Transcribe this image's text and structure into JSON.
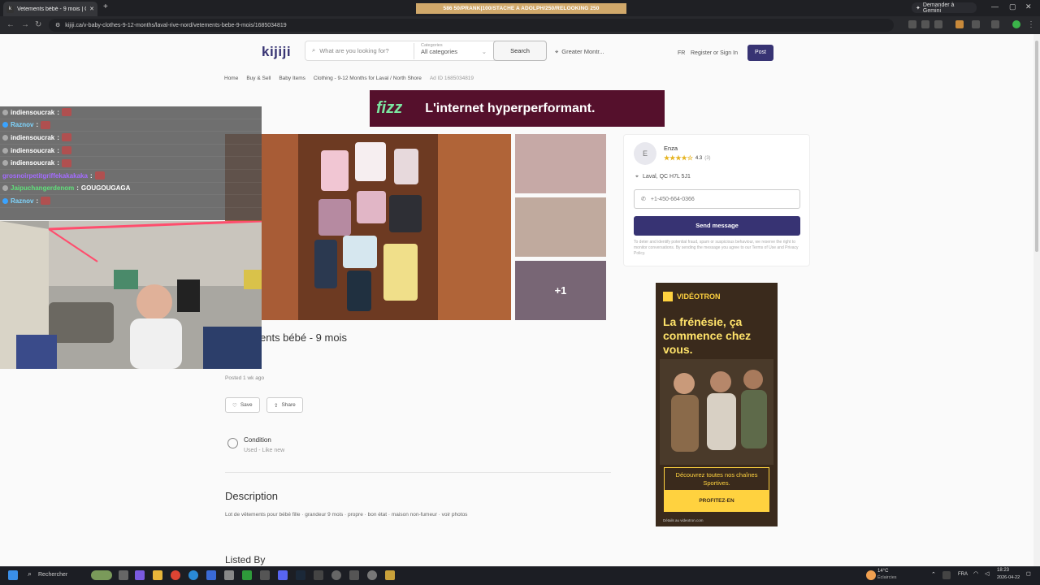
{
  "browser": {
    "tab_title": "Vetements bébé - 9 mois | Clo",
    "tab_favicon": "k",
    "new_tab": "+",
    "stream_banner": "586        50/PRANK|100/STACHE A ADOLPH/250/RELOOKING 250",
    "gemini_label": "Demander à Gemini",
    "url": "kijiji.ca/v-baby-clothes-9-12-months/laval-rive-nord/vetements-bebe-9-mois/1685034819",
    "controls": [
      "—",
      "▢",
      "✕"
    ]
  },
  "header": {
    "logo": "kijiji",
    "search_placeholder": "What are you looking for?",
    "categories_label": "Categories",
    "categories_value": "All categories",
    "search_button": "Search",
    "location": "Greater Montr...",
    "lang": "FR",
    "register": "Register or Sign In",
    "post_button": "Post"
  },
  "breadcrumb": [
    "Home",
    "Buy & Sell",
    "Baby Items",
    "Clothing - 9-12 Months for Laval / North Shore",
    "Ad ID 1685034819"
  ],
  "top_ad": {
    "brand": "fizz",
    "slogan": "L'internet hyperperformant."
  },
  "listing": {
    "title": "ents bébé - 9 mois",
    "more_photos": "+1",
    "posted": "Posted 1 wk ago",
    "save": "Save",
    "share": "Share",
    "condition_label": "Condition",
    "condition_value": "Used - Like new",
    "description_heading": "Description",
    "description": "Lot de vêtements pour bébé fille · grandeur 9 mois · propre · bon état · maison non-fumeur · voir photos",
    "listed_by": "Listed By"
  },
  "seller": {
    "initial": "E",
    "name": "Enza",
    "stars": "★★★★☆",
    "rating": "4.3",
    "reviews": "(3)",
    "location": "Laval, QC H7L 5J1",
    "phone": "+1-450-664-0366",
    "send": "Send message",
    "fine_print": "To deter and identify potential fraud, spam or suspicious behaviour, we reserve the right to monitor conversations. By sending the message you agree to our Terms of Use and Privacy Policy."
  },
  "side_ad": {
    "brand": "VIDÉOTRON",
    "headline": "La frénésie, ça commence chez vous.",
    "box": "Découvrez toutes nos chaînes Sportives.",
    "cta": "PROFITEZ-EN",
    "tiny": "Détails au videotron.com"
  },
  "chat": [
    {
      "user": "indiensoucrak",
      "msg": "",
      "color": "#ffffff",
      "badge": "g"
    },
    {
      "user": "Raznov",
      "msg": "",
      "color": "#7fd6ff",
      "badge": "b"
    },
    {
      "user": "indiensoucrak",
      "msg": "",
      "color": "#ffffff",
      "badge": "g"
    },
    {
      "user": "indiensoucrak",
      "msg": "",
      "color": "#ffffff",
      "badge": "g"
    },
    {
      "user": "indiensoucrak",
      "msg": "",
      "color": "#ffffff",
      "badge": "g"
    },
    {
      "user": "grosnoirpetitgriffekakakaka",
      "msg": "",
      "color": "#a46bff",
      "badge": ""
    },
    {
      "user": "Jaipuchangerdenom",
      "msg": "GOUGOUGAGA",
      "color": "#5fe07a",
      "badge": "g"
    },
    {
      "user": "Raznov",
      "msg": "",
      "color": "#7fd6ff",
      "badge": "b"
    }
  ],
  "taskbar": {
    "search": "Rechercher",
    "weather_temp": "14°C",
    "weather_desc": "Éclaircies",
    "lang": "FRA",
    "time": "18:23",
    "date": "2026-04-22"
  }
}
